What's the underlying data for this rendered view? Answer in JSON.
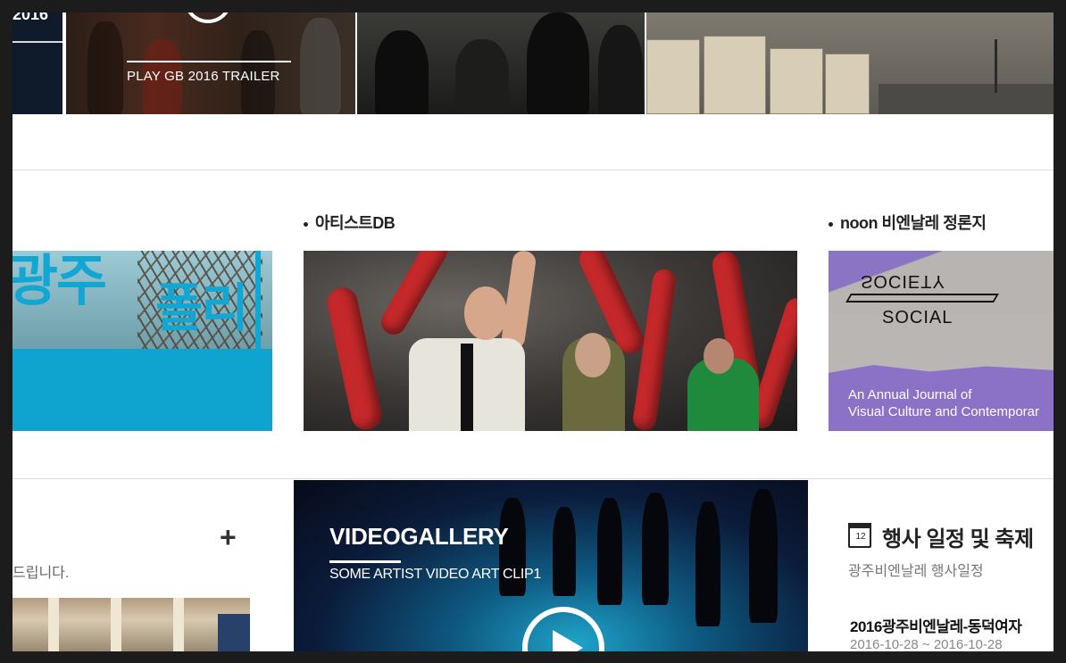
{
  "top": {
    "year_badge": "2016",
    "trailer_caption": "PLAY GB 2016 TRAILER"
  },
  "sections": {
    "artist_db_title": "아티스트DB",
    "noon_title": "noon 비엔날레 정론지"
  },
  "cards": {
    "left_title_a": "광주",
    "left_title_b": "폴리",
    "noon_word_flipped": "SOCIETY",
    "noon_word": "SOCIAL",
    "noon_journal_line1": "An Annual Journal of",
    "noon_journal_line2": "Visual Culture and Contemporar"
  },
  "notice": {
    "plus_label": "+",
    "description": "드립니다."
  },
  "videogallery": {
    "title": "VIDEOGALLERY",
    "subtitle": "SOME ARTIST VIDEO ART CLIP1"
  },
  "events": {
    "calendar_day": "12",
    "title": "행사 일정 및 축제",
    "subtitle": "광주비엔날레 행사일정",
    "item_title": "2016광주비엔날레-동덕여자",
    "item_date": "2016-10-28 ~ 2016-10-28"
  }
}
